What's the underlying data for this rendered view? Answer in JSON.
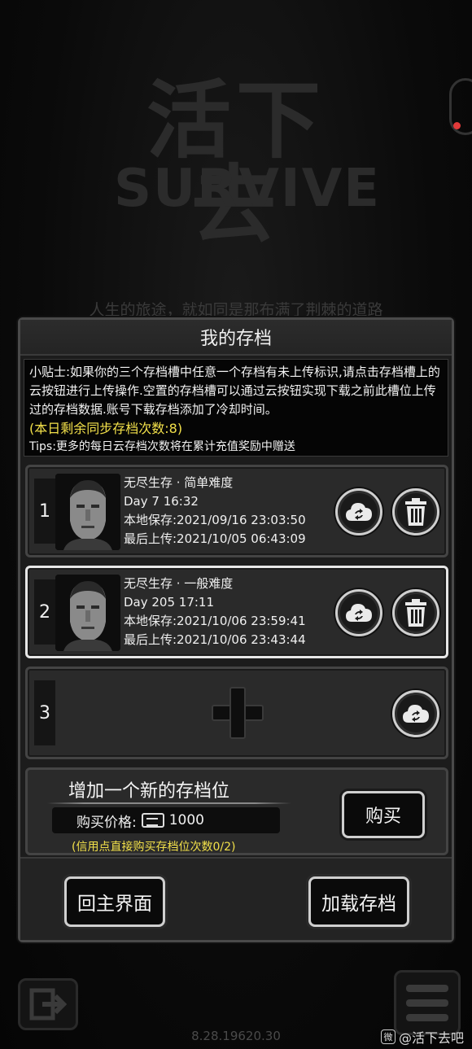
{
  "background": {
    "logo_cn": "活下去",
    "logo_en": "SURVIVE",
    "tagline": "人生的旅途，就如同是那布满了荆棘的道路",
    "version": "8.28.19620.30",
    "watermark": "@活下去吧"
  },
  "dialog": {
    "title": "我的存档",
    "tips": {
      "main": "小贴士:如果你的三个存档槽中任意一个存档有未上传标识,请点击存档槽上的云按钮进行上传操作.空置的存档槽可以通过云按钮实现下载之前此槽位上传过的存档数据.账号下载存档添加了冷却时间。",
      "sync_count": "(本日剩余同步存档次数:8)",
      "extra": "Tips:更多的每日云存档次数将在累计充值奖励中赠送"
    },
    "slots": [
      {
        "number": "1",
        "mode": "无尽生存 · 简单难度",
        "day": "Day 7   16:32",
        "local_save": "本地保存:2021/09/16   23:03:50",
        "last_upload": "最后上传:2021/10/05   06:43:09"
      },
      {
        "number": "2",
        "mode": "无尽生存 · 一般难度",
        "day": "Day 205   17:11",
        "local_save": "本地保存:2021/10/06   23:59:41",
        "last_upload": "最后上传:2021/10/06   23:43:44"
      },
      {
        "number": "3"
      }
    ],
    "buy": {
      "title": "增加一个新的存档位",
      "price_label": "购买价格:",
      "price_value": "1000",
      "note": "(信用点直接购买存档位次数0/2)",
      "buy_button": "购买"
    },
    "footer": {
      "home_button": "回主界面",
      "load_button": "加载存档"
    }
  },
  "icons": {
    "cloud": "cloud-sync-icon",
    "trash": "trash-icon",
    "plus": "plus-icon",
    "ticket": "credit-ticket-icon",
    "exit": "exit-icon",
    "menu": "menu-icon"
  },
  "colors": {
    "highlight_yellow": "#f2e04a",
    "selected_border": "#e6e6e6",
    "alert_dot": "#e23a3a"
  }
}
